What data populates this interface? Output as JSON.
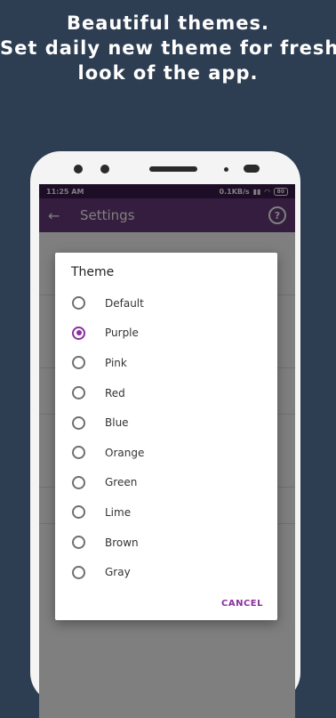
{
  "headline": {
    "line1": "Beautiful themes.",
    "line2": "Set daily new theme for fresh",
    "line3": "look of the app."
  },
  "statusbar": {
    "time": "11:25 AM",
    "speed": "0.1KB/s",
    "battery": "80"
  },
  "toolbar": {
    "title": "Settings",
    "back_icon": "arrow-back-icon",
    "help_icon": "help-circle-icon"
  },
  "dialog": {
    "title": "Theme",
    "options": [
      {
        "label": "Default",
        "checked": false
      },
      {
        "label": "Purple",
        "checked": true
      },
      {
        "label": "Pink",
        "checked": false
      },
      {
        "label": "Red",
        "checked": false
      },
      {
        "label": "Blue",
        "checked": false
      },
      {
        "label": "Orange",
        "checked": false
      },
      {
        "label": "Green",
        "checked": false
      },
      {
        "label": "Lime",
        "checked": false
      },
      {
        "label": "Brown",
        "checked": false
      },
      {
        "label": "Gray",
        "checked": false
      }
    ],
    "cancel_label": "CANCEL"
  },
  "colors": {
    "background": "#2e3e52",
    "statusbar": "#3c1a4d",
    "toolbar": "#6a3a7e",
    "accent": "#8a2fa0"
  }
}
